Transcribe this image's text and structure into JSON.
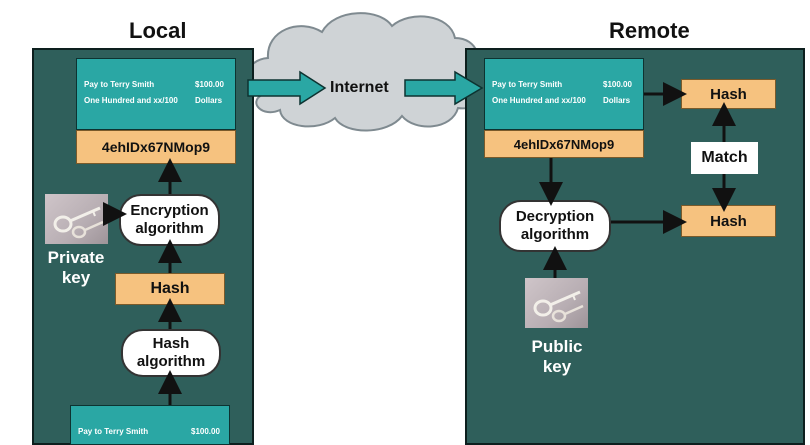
{
  "local": {
    "title": "Local",
    "check_top": {
      "line1_left": "Pay to Terry Smith",
      "line1_right": "$100.00",
      "line2_left": "One Hundred and xx/100",
      "line2_right": "Dollars"
    },
    "signature": "4ehIDx67NMop9",
    "encryption_algorithm": [
      "Encryption",
      "algorithm"
    ],
    "private_key": [
      "Private",
      "key"
    ],
    "hash": "Hash",
    "hash_algorithm": [
      "Hash",
      "algorithm"
    ],
    "check_bottom": {
      "line1_left": "Pay to Terry Smith",
      "line1_right": "$100.00"
    }
  },
  "internet": {
    "label": "Internet"
  },
  "remote": {
    "title": "Remote",
    "check": {
      "line1_left": "Pay to Terry Smith",
      "line1_right": "$100.00",
      "line2_left": "One Hundred and xx/100",
      "line2_right": "Dollars"
    },
    "signature": "4ehIDx67NMop9",
    "hash_top": "Hash",
    "match": "Match",
    "hash_bottom": "Hash",
    "decryption_algorithm": [
      "Decryption",
      "algorithm"
    ],
    "public_key": [
      "Public",
      "key"
    ]
  },
  "colors": {
    "panel": "#2f5f5b",
    "check": "#2aa7a4",
    "orange": "#f6c27f",
    "cloud": "#cfd3d6",
    "arrow_fill": "#2aa7a4"
  }
}
